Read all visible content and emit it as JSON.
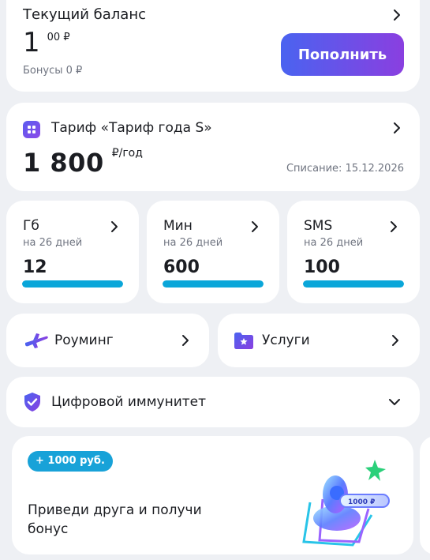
{
  "balance": {
    "title": "Текущий баланс",
    "amount_int": "1",
    "amount_frac": "00 ₽",
    "bonus": "Бонусы 0 ₽",
    "topup_label": "Пополнить"
  },
  "tariff": {
    "name": "Тариф «Тариф года S»",
    "price": "1 800",
    "price_unit": "₽/год",
    "charge": "Списание: 15.12.2026"
  },
  "counters": [
    {
      "title": "Гб",
      "period": "на 26 дней",
      "value": "12",
      "fill": 1.0
    },
    {
      "title": "Мин",
      "period": "на 26 дней",
      "value": "600",
      "fill": 1.0
    },
    {
      "title": "SMS",
      "period": "на 26 дней",
      "value": "100",
      "fill": 1.0
    }
  ],
  "roaming": {
    "label": "Роуминг",
    "icon": "airplane-icon"
  },
  "services": {
    "label": "Услуги",
    "icon": "star-folder-icon"
  },
  "immunity": {
    "label": "Цифровой иммунитет",
    "icon": "shield-check-icon"
  },
  "promo": {
    "badge": "+ 1000 руб.",
    "text": "Приведи друга и получи бонус",
    "art_text": "1000 ₽"
  },
  "colors": {
    "accent_start": "#4a63f0",
    "accent_end": "#8a3fe0",
    "progress": "#0aa6d9",
    "badge": "#18a2d8"
  }
}
